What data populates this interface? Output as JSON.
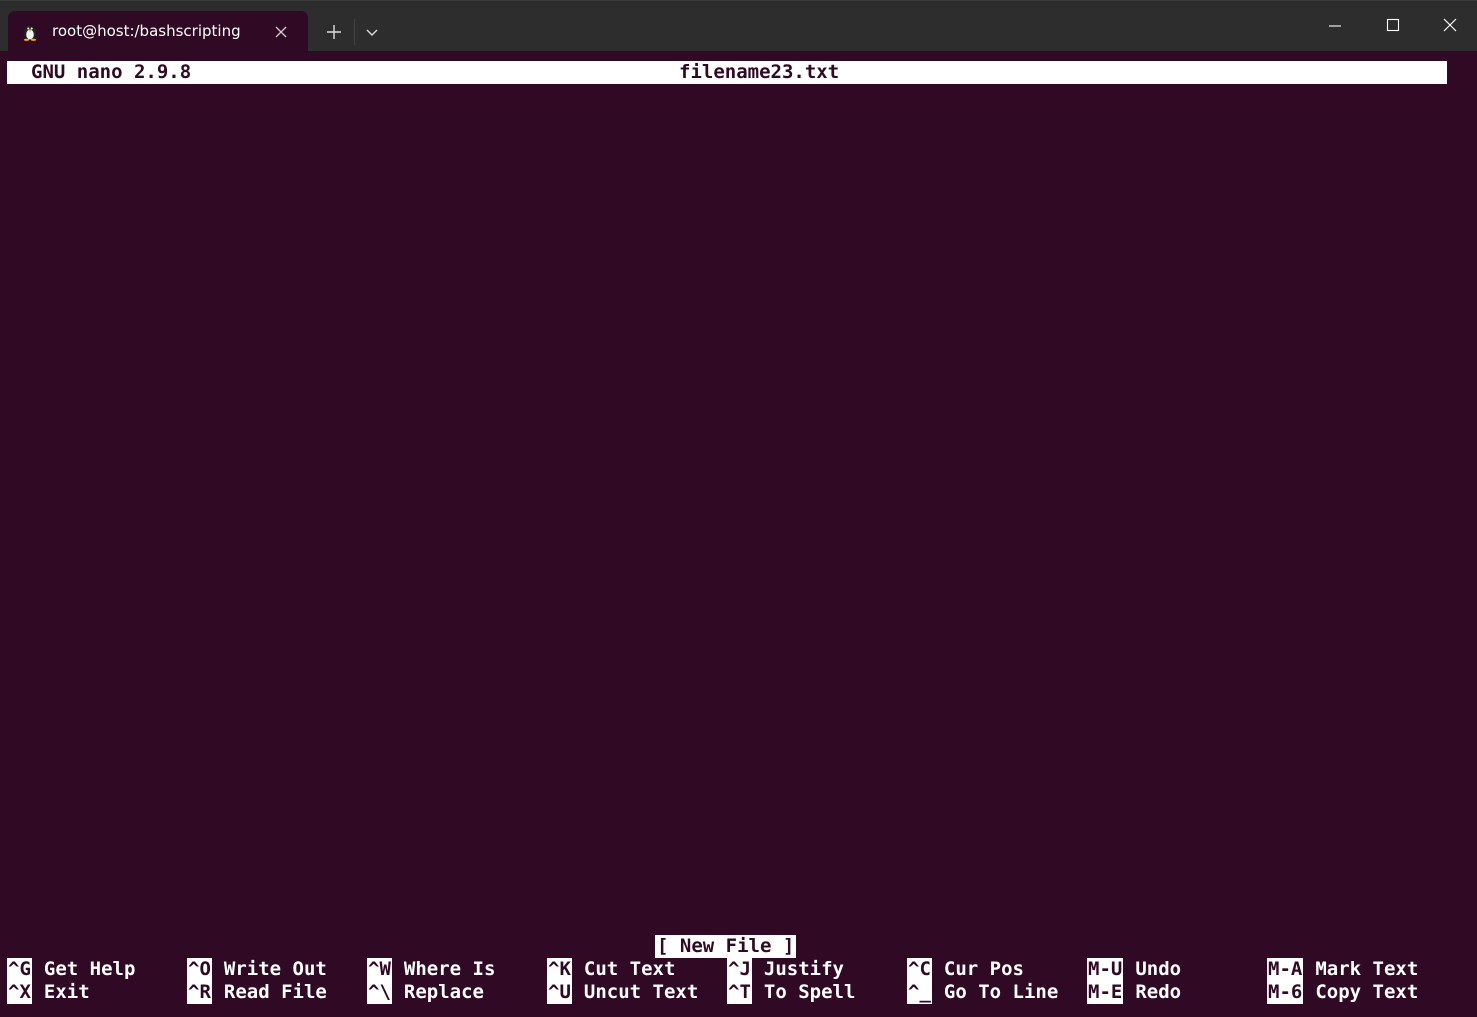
{
  "window": {
    "tab_title": "root@host:/bashscripting",
    "tab_icon": "linux-penguin-icon"
  },
  "nano": {
    "version": "GNU nano 2.9.8",
    "filename": "filename23.txt",
    "status": "[ New File ]"
  },
  "shortcuts": {
    "row1": [
      {
        "key": "^G",
        "label": "Get Help"
      },
      {
        "key": "^O",
        "label": "Write Out"
      },
      {
        "key": "^W",
        "label": "Where Is"
      },
      {
        "key": "^K",
        "label": "Cut Text"
      },
      {
        "key": "^J",
        "label": "Justify"
      },
      {
        "key": "^C",
        "label": "Cur Pos"
      },
      {
        "key": "M-U",
        "label": "Undo"
      },
      {
        "key": "M-A",
        "label": "Mark Text"
      }
    ],
    "row2": [
      {
        "key": "^X",
        "label": "Exit"
      },
      {
        "key": "^R",
        "label": "Read File"
      },
      {
        "key": "^\\",
        "label": "Replace"
      },
      {
        "key": "^U",
        "label": "Uncut Text"
      },
      {
        "key": "^T",
        "label": "To Spell"
      },
      {
        "key": "^_",
        "label": "Go To Line"
      },
      {
        "key": "M-E",
        "label": "Redo"
      },
      {
        "key": "M-6",
        "label": "Copy Text"
      }
    ]
  },
  "colors": {
    "terminal_bg": "#300a24",
    "titlebar_bg": "#2d2d2d",
    "highlight_fg": "#ffffff"
  }
}
